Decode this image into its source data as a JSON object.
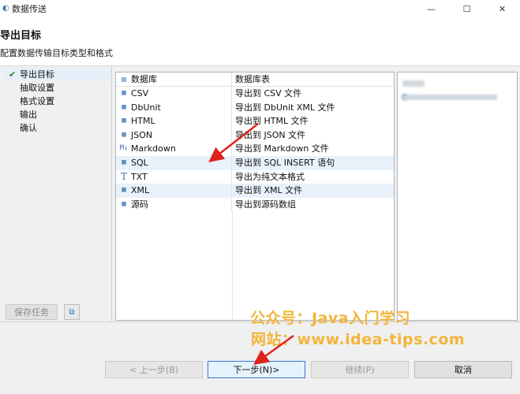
{
  "window": {
    "title": "数据传送",
    "minimize": "—",
    "maximize": "☐",
    "close": "✕"
  },
  "header": {
    "title": "导出目标",
    "subtitle": "配置数据传输目标类型和格式"
  },
  "nav": {
    "items": [
      {
        "label": "导出目标",
        "active": true
      },
      {
        "label": "抽取设置"
      },
      {
        "label": "格式设置"
      },
      {
        "label": "输出"
      },
      {
        "label": "确认"
      }
    ]
  },
  "table": {
    "headers": [
      "数据库",
      "数据库表"
    ],
    "rows": [
      {
        "name": "CSV",
        "icon": "csv-file-icon",
        "desc": "导出到 CSV 文件"
      },
      {
        "name": "DbUnit",
        "icon": "dbunit-file-icon",
        "desc": "导出到 DbUnit XML 文件"
      },
      {
        "name": "HTML",
        "icon": "html-file-icon",
        "desc": "导出到 HTML 文件"
      },
      {
        "name": "JSON",
        "icon": "json-file-icon",
        "desc": "导出到 JSON 文件"
      },
      {
        "name": "Markdown",
        "icon": "markdown-icon",
        "desc": "导出到 Markdown 文件"
      },
      {
        "name": "SQL",
        "icon": "sql-file-icon",
        "desc": "导出到 SQL INSERT 语句"
      },
      {
        "name": "TXT",
        "icon": "text-icon",
        "desc": "导出为纯文本格式"
      },
      {
        "name": "XML",
        "icon": "xml-file-icon",
        "desc": "导出到 XML 文件"
      },
      {
        "name": "源码",
        "icon": "source-code-icon",
        "desc": "导出到源码数组"
      }
    ]
  },
  "left_bottom": {
    "save_task": "保存任务"
  },
  "footer": {
    "back": "< 上一步(B)",
    "next": "下一步(N)>",
    "continue": "继续(P)",
    "cancel": "取消"
  },
  "watermark": {
    "line1": "公众号：Java入门学习",
    "line2": "网站：www.idea-tips.com"
  },
  "colors": {
    "accent": "#2f7bd4",
    "arrow": "#e0201b",
    "watermark": "#f3b43a"
  }
}
